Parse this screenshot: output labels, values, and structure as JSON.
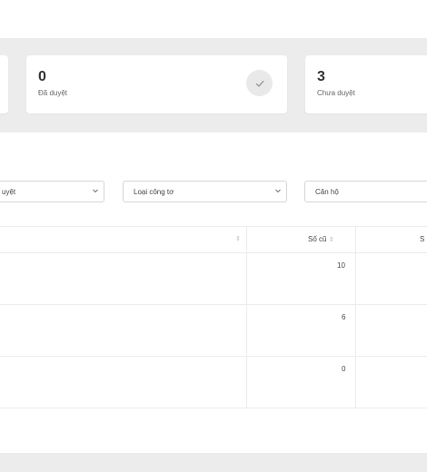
{
  "stats": [
    {
      "value": "0",
      "label": "Đã duyệt"
    },
    {
      "value": "3",
      "label": "Chưa duyệt"
    }
  ],
  "filters": {
    "status_partial": "uyệt",
    "meter_type": "Loại công tơ",
    "apartment": "Căn hộ"
  },
  "table": {
    "headers": {
      "old_reading": "Số cũ",
      "partial_next": "S"
    },
    "rows": [
      {
        "old_reading": "10"
      },
      {
        "old_reading": "6"
      },
      {
        "old_reading": "0"
      }
    ]
  },
  "icons": {
    "check": "check-icon",
    "chevron": "chevron-down-icon",
    "sort": "sort-icon"
  }
}
